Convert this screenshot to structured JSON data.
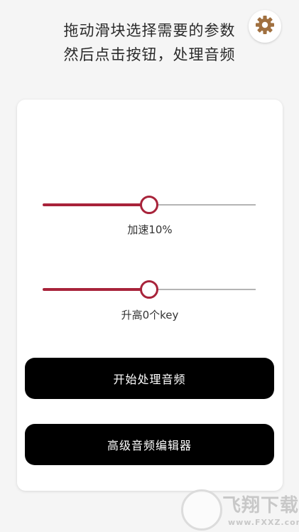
{
  "header": {
    "line1": "拖动滑块选择需要的参数",
    "line2": "然后点击按钮，处理音频"
  },
  "settings": {
    "icon": "gear-icon"
  },
  "speed_slider": {
    "label": "加速10%",
    "value_fraction": 0.5,
    "accent_color": "#a8233a",
    "track_color": "#b4b4b4"
  },
  "pitch_slider": {
    "label": "升高0个key",
    "value_fraction": 0.5,
    "accent_color": "#a8233a",
    "track_color": "#b4b4b4"
  },
  "buttons": {
    "start_label": "开始处理音频",
    "editor_label": "高级音频编辑器"
  },
  "watermark": {
    "brand": "飞翔下载",
    "site": "www.FXXZ.com"
  }
}
